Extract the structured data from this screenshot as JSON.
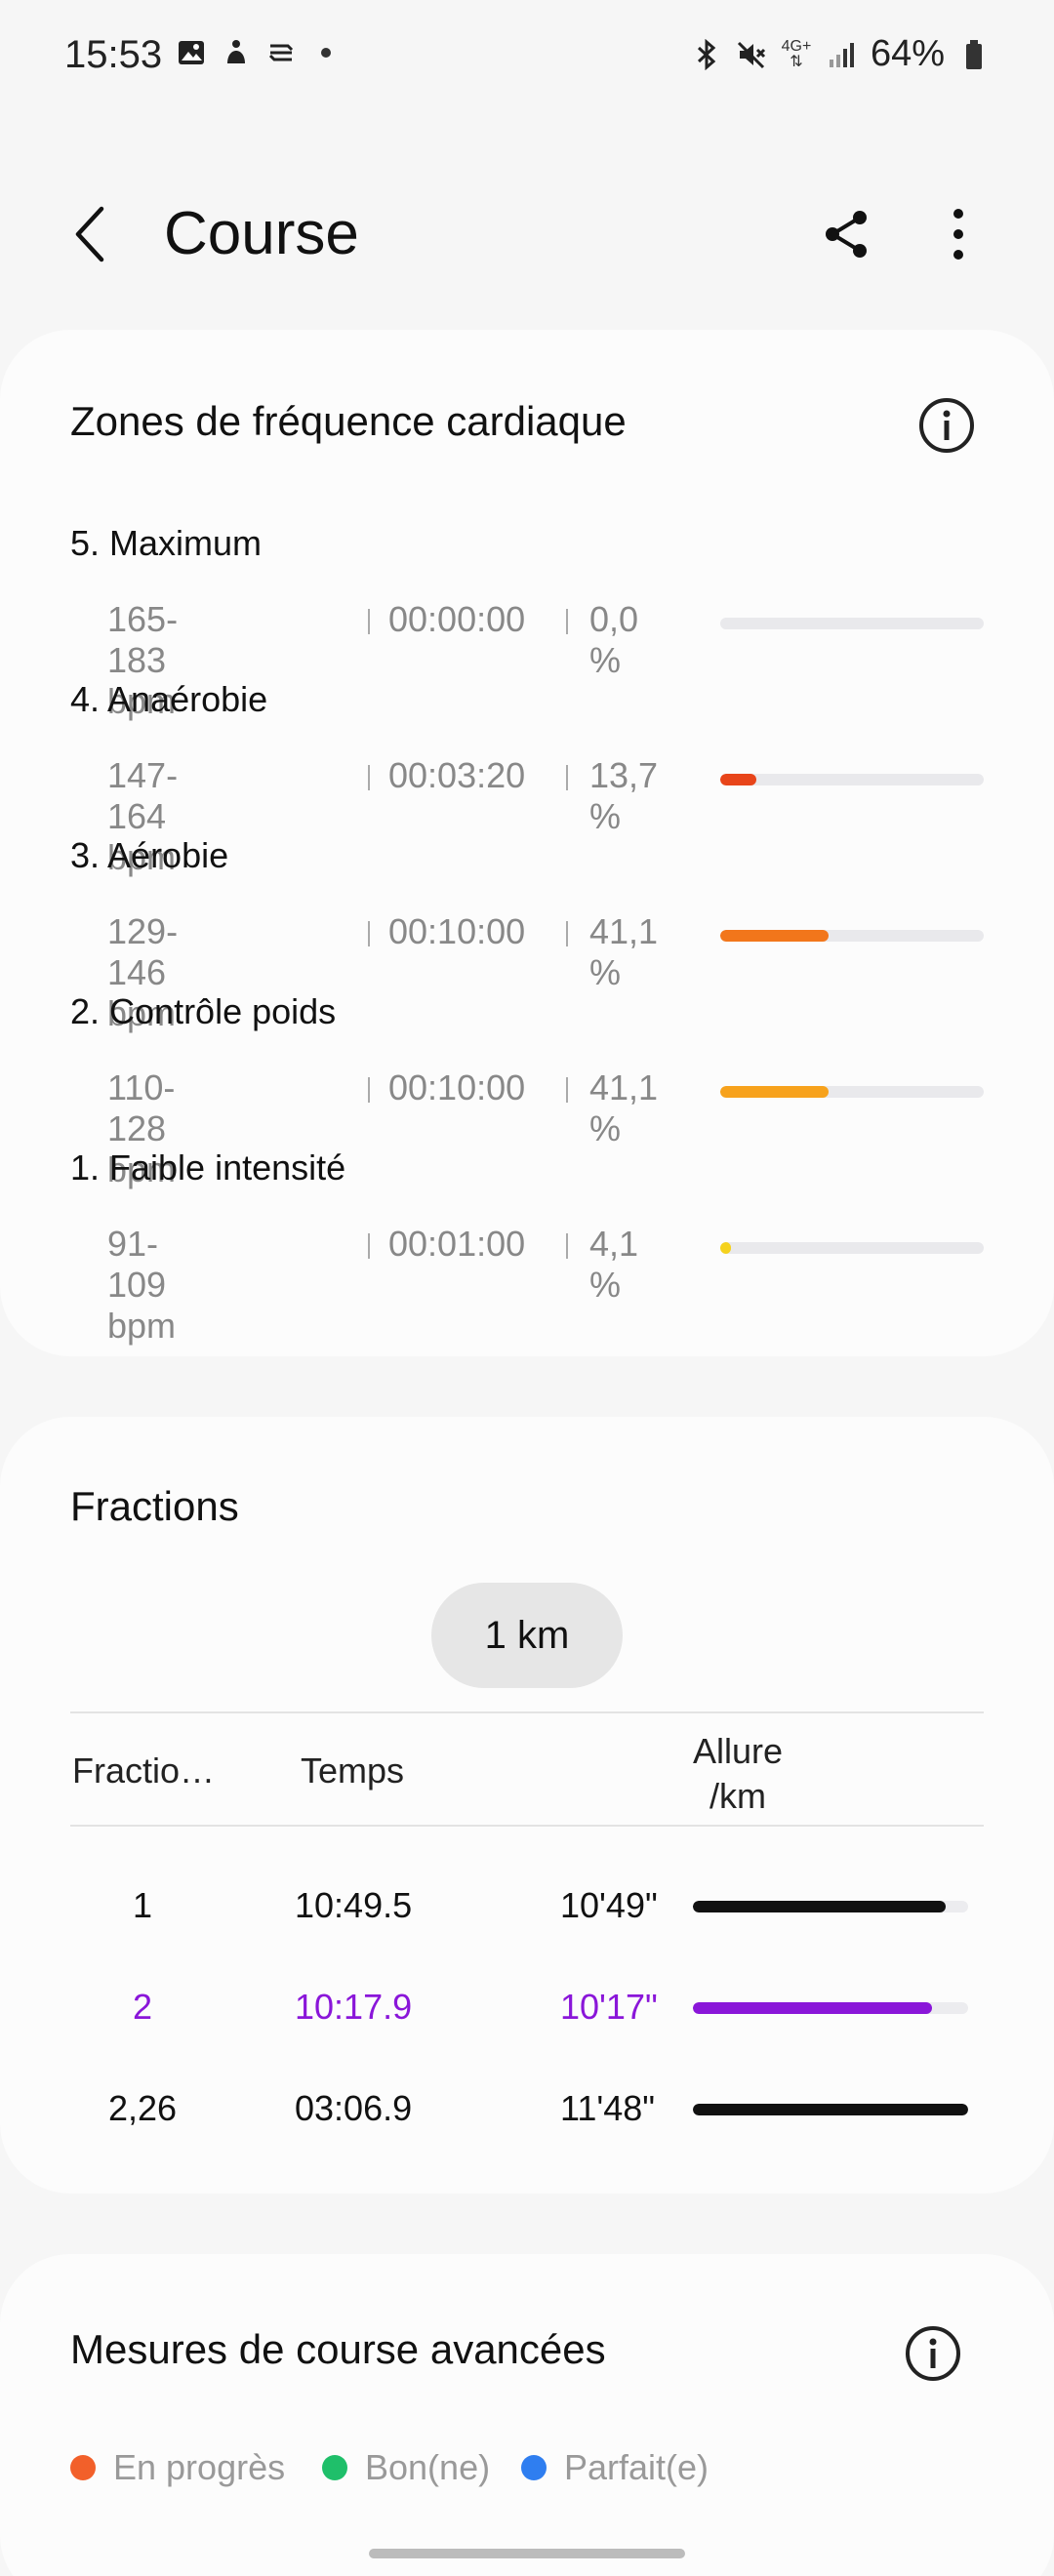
{
  "status_bar": {
    "time": "15:53",
    "battery": "64%",
    "network": "4G+"
  },
  "app_bar": {
    "title": "Course"
  },
  "hr_zones": {
    "title": "Zones de fréquence cardiaque",
    "zones": [
      {
        "name": "5. Maximum",
        "bpm": "165-183 bpm",
        "time": "00:00:00",
        "percent": "0,0 %",
        "fraction": 0.0,
        "color": "#e74c1b"
      },
      {
        "name": "4. Anaérobie",
        "bpm": "147-164 bpm",
        "time": "00:03:20",
        "percent": "13,7 %",
        "fraction": 0.137,
        "color": "#e8451a"
      },
      {
        "name": "3. Aérobie",
        "bpm": "129-146 bpm",
        "time": "00:10:00",
        "percent": "41,1 %",
        "fraction": 0.411,
        "color": "#f2761b"
      },
      {
        "name": "2. Contrôle poids",
        "bpm": "110-128 bpm",
        "time": "00:10:00",
        "percent": "41,1 %",
        "fraction": 0.411,
        "color": "#f7a21c"
      },
      {
        "name": "1. Faible intensité",
        "bpm": "91-109 bpm",
        "time": "00:01:00",
        "percent": "4,1 %",
        "fraction": 0.041,
        "color": "#f5d21d"
      }
    ]
  },
  "fractions": {
    "title": "Fractions",
    "chip_label": "1 km",
    "headers": {
      "split": "Fractio…",
      "time": "Temps",
      "pace_line1": "Allure",
      "pace_line2": "/km"
    },
    "rows": [
      {
        "split": "1",
        "time": "10:49.5",
        "pace": "10'49\"",
        "bar_fraction": 0.92,
        "highlight": false,
        "color": "#111111"
      },
      {
        "split": "2",
        "time": "10:17.9",
        "pace": "10'17\"",
        "bar_fraction": 0.87,
        "highlight": true,
        "color": "#8a16d9"
      },
      {
        "split": "2,26",
        "time": "03:06.9",
        "pace": "11'48\"",
        "bar_fraction": 1.0,
        "highlight": false,
        "color": "#111111"
      }
    ]
  },
  "advanced": {
    "title": "Mesures de course avancées",
    "legend": [
      {
        "label": "En progrès",
        "color": "#f2602a"
      },
      {
        "label": "Bon(ne)",
        "color": "#1fbf6a"
      },
      {
        "label": "Parfait(e)",
        "color": "#2f7ef0"
      }
    ]
  }
}
